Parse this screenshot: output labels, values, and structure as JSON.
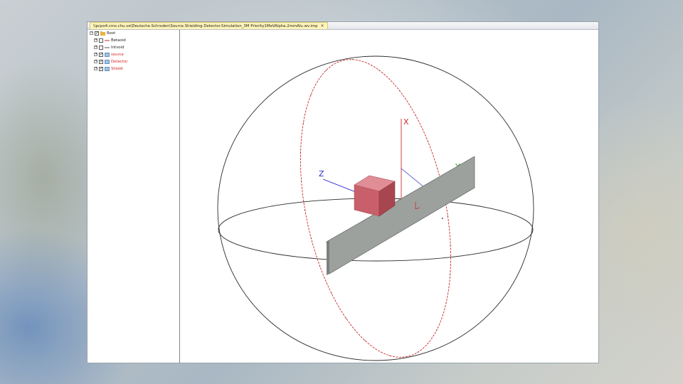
{
  "window": {
    "tab_title": "\\\\pcpo4.cms.chu.ve\\Deutsche.Schrsden\\Source.Shielding.Detector.Simulation_3M Priority1MeVAlpha.2mmAlu.wv.imp",
    "tab_close": "×"
  },
  "tree": {
    "root": {
      "label": "Root",
      "checked": true
    },
    "items": [
      {
        "label": "Betaoid",
        "checked": false,
        "color": "#222222"
      },
      {
        "label": "Intvoid",
        "checked": false,
        "color": "#222222"
      },
      {
        "label": "source",
        "checked": true,
        "color": "#d42020"
      },
      {
        "label": "Detector",
        "checked": true,
        "color": "#d42020"
      },
      {
        "label": "Shield",
        "checked": true,
        "color": "#d42020"
      }
    ],
    "expand_glyph": "+",
    "check_glyph": "✓"
  },
  "viewport": {
    "axes": {
      "x": "X",
      "y": "Y",
      "z": "Z"
    },
    "colors": {
      "sphere_outline": "#2b2b2b",
      "sphere_meridian": "#cc2a2a",
      "cube_front": "#c85f6a",
      "cube_top": "#e08d96",
      "cube_side": "#a84650",
      "slab_face": "#9da19e",
      "slab_edge": "#6b6f6d",
      "axis_x": "#cc2a2a",
      "axis_y": "#2aa52a",
      "axis_z": "#2a2acc"
    }
  }
}
